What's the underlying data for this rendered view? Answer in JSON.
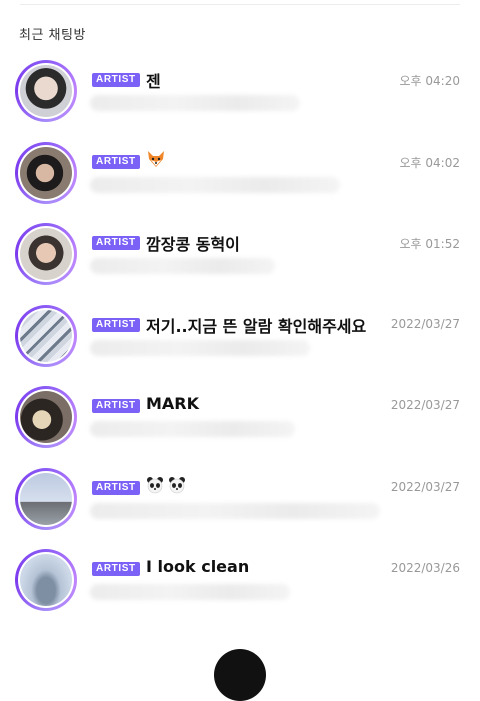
{
  "section": {
    "title": "최근 채팅방"
  },
  "chats": [
    {
      "badge": "ARTIST",
      "name": "젠",
      "time": "오후 04:20",
      "avatar_icon": "artist-avatar-1"
    },
    {
      "badge": "ARTIST",
      "name": "",
      "name_icon": "fox-emoji-icon",
      "time": "오후 04:02",
      "avatar_icon": "artist-avatar-2"
    },
    {
      "badge": "ARTIST",
      "name": "깜장콩 동혁이",
      "time": "오후 01:52",
      "avatar_icon": "artist-avatar-3"
    },
    {
      "badge": "ARTIST",
      "name": "저기..지금 뜬 알람 확인해주세요",
      "time": "2022/03/27",
      "avatar_icon": "artist-avatar-4"
    },
    {
      "badge": "ARTIST",
      "name": "MARK",
      "time": "2022/03/27",
      "avatar_icon": "artist-avatar-5"
    },
    {
      "badge": "ARTIST",
      "name": "",
      "name_icon": "panda-emoji-icon",
      "time": "2022/03/27",
      "avatar_icon": "artist-avatar-6"
    },
    {
      "badge": "ARTIST",
      "name": "I look clean",
      "time": "2022/03/26",
      "avatar_icon": "artist-avatar-7"
    }
  ],
  "colors": {
    "badge_bg": "#7b61f5",
    "ring_start": "#8b5cf6",
    "ring_end": "#c084fc",
    "time_text": "#999999"
  }
}
